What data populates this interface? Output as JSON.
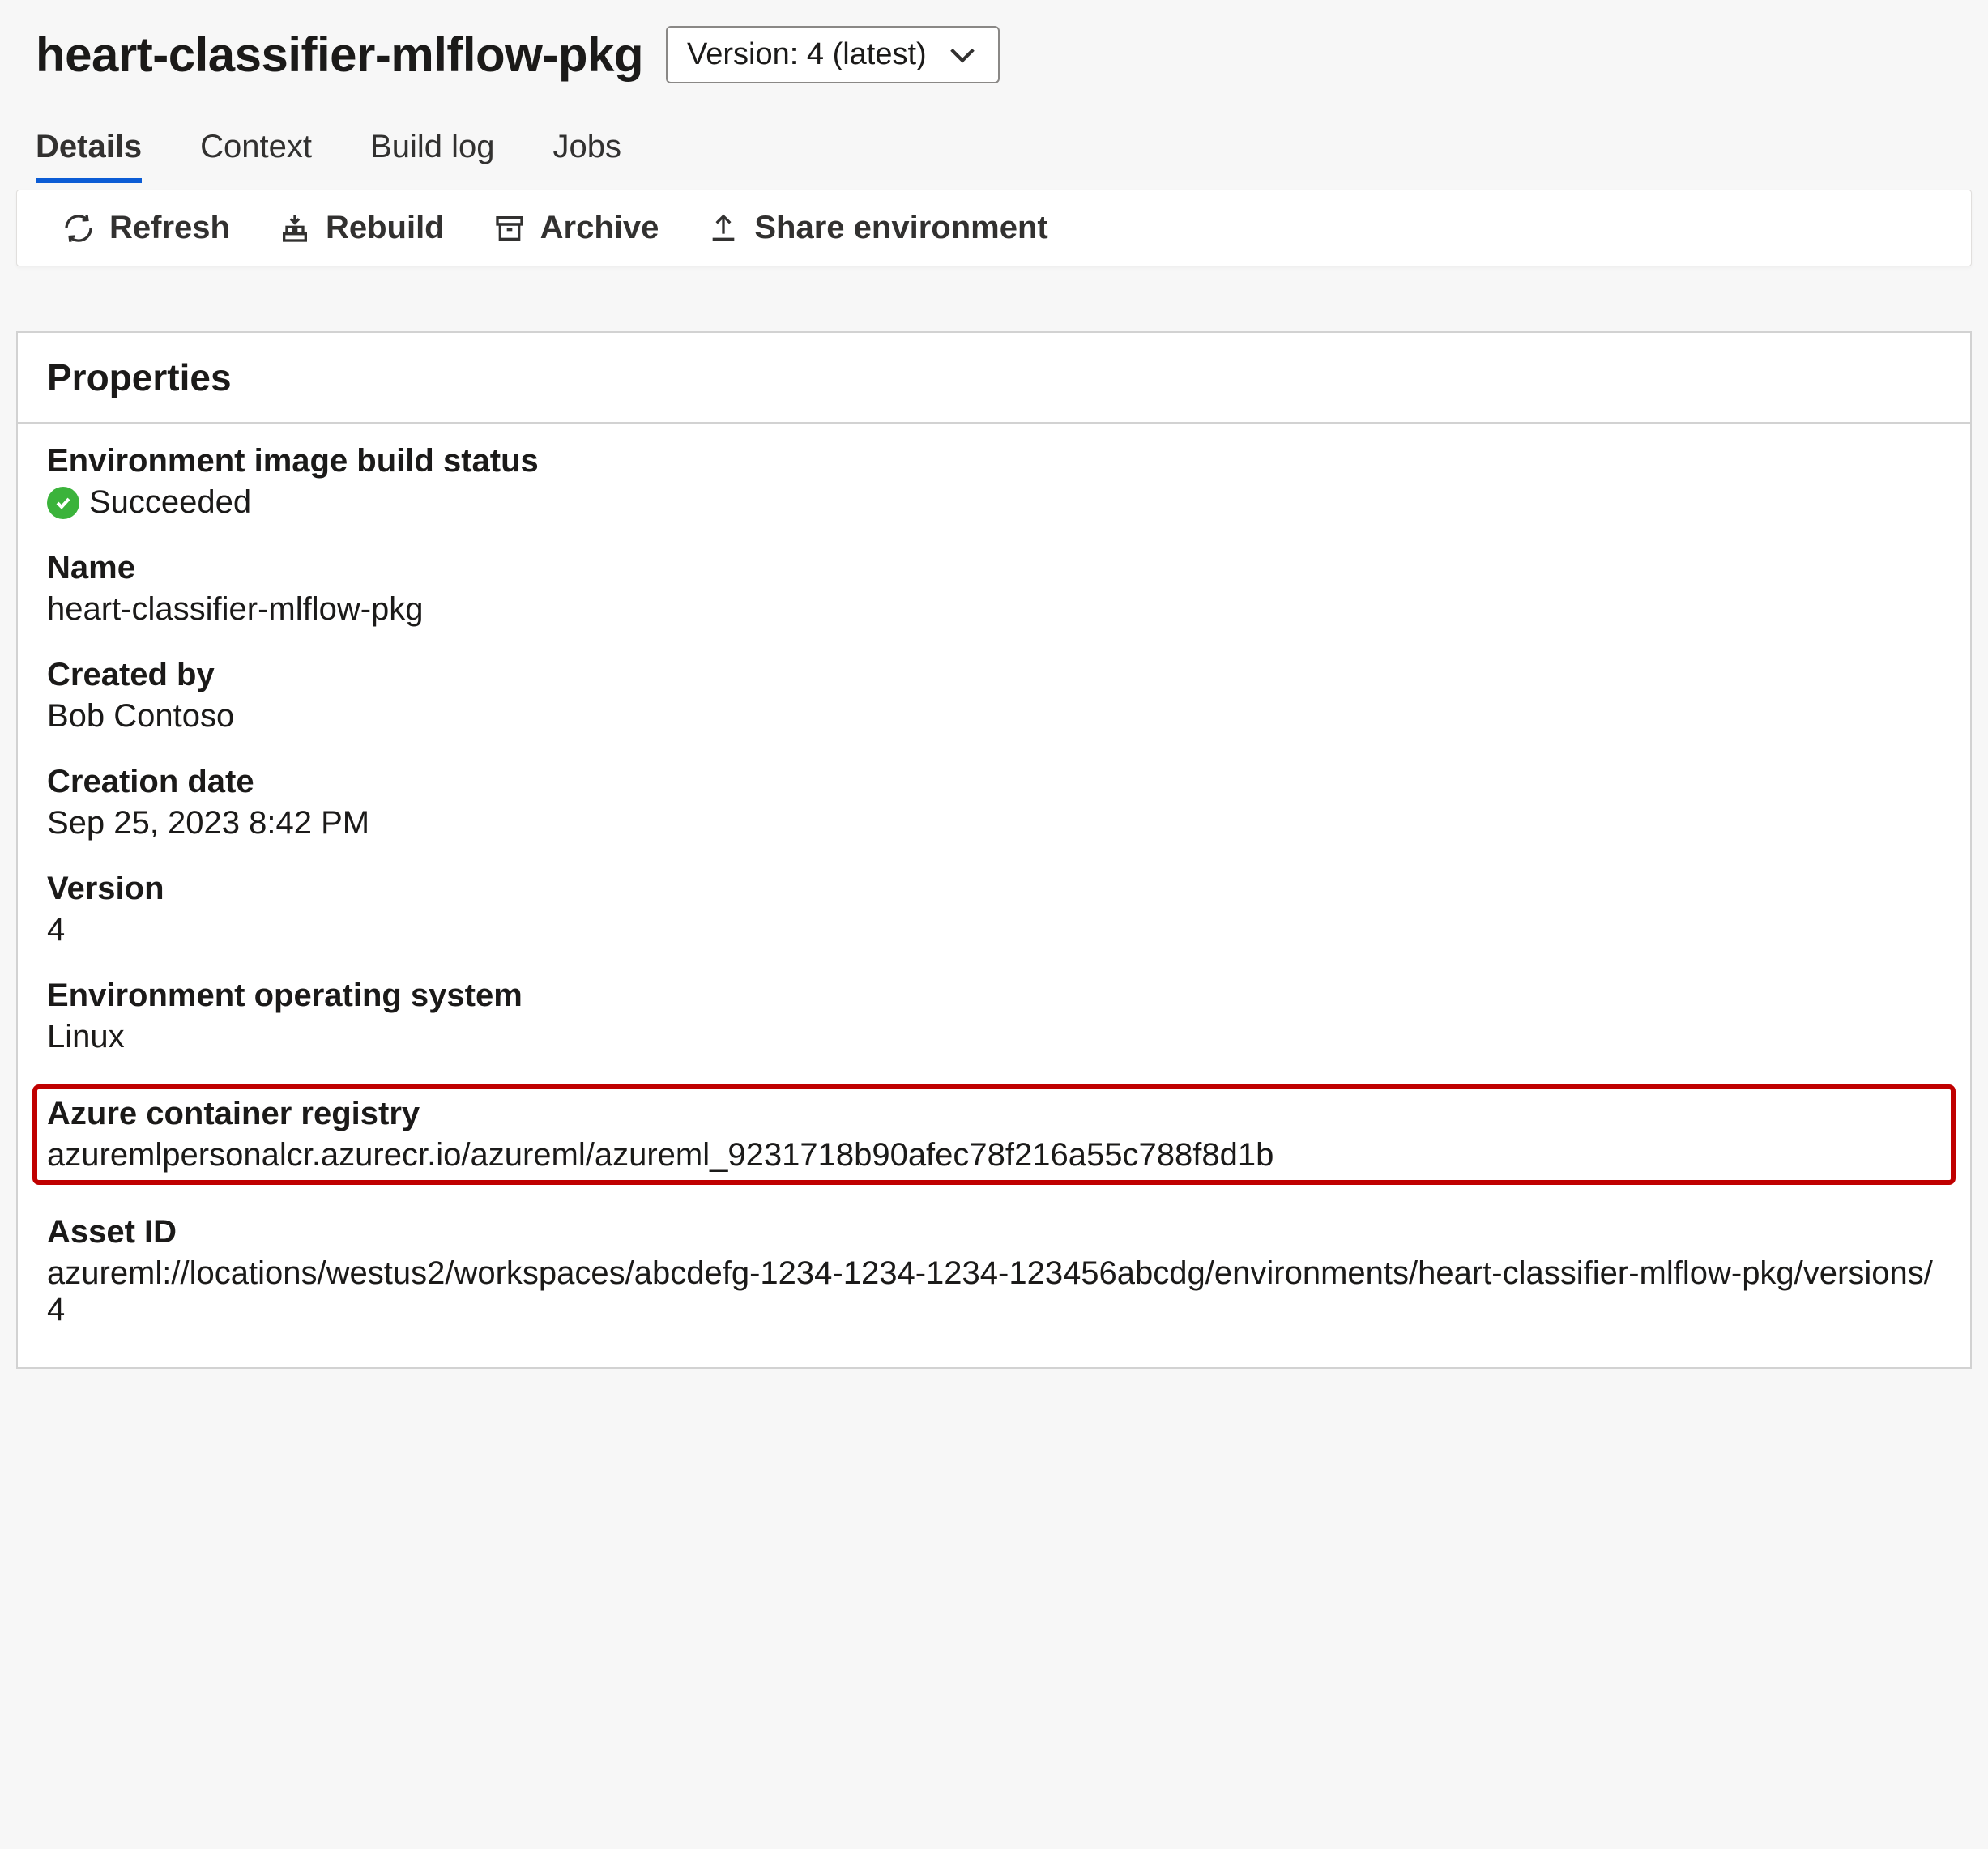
{
  "header": {
    "title": "heart-classifier-mlflow-pkg",
    "version_selector": "Version: 4 (latest)"
  },
  "tabs": [
    {
      "label": "Details",
      "active": true
    },
    {
      "label": "Context",
      "active": false
    },
    {
      "label": "Build log",
      "active": false
    },
    {
      "label": "Jobs",
      "active": false
    }
  ],
  "toolbar": {
    "refresh": "Refresh",
    "rebuild": "Rebuild",
    "archive": "Archive",
    "share": "Share environment"
  },
  "panel": {
    "title": "Properties",
    "props": {
      "build_status": {
        "label": "Environment image build status",
        "value": "Succeeded"
      },
      "name": {
        "label": "Name",
        "value": "heart-classifier-mlflow-pkg"
      },
      "created_by": {
        "label": "Created by",
        "value": "Bob Contoso"
      },
      "creation_date": {
        "label": "Creation date",
        "value": "Sep 25, 2023 8:42 PM"
      },
      "version": {
        "label": "Version",
        "value": "4"
      },
      "os": {
        "label": "Environment operating system",
        "value": "Linux"
      },
      "acr": {
        "label": "Azure container registry",
        "value": "azuremlpersonalcr.azurecr.io/azureml/azureml_9231718b90afec78f216a55c788f8d1b"
      },
      "asset_id": {
        "label": "Asset ID",
        "value": "azureml://locations/westus2/workspaces/abcdefg-1234-1234-1234-123456abcdg/environments/heart-classifier-mlflow-pkg/versions/4"
      }
    }
  }
}
